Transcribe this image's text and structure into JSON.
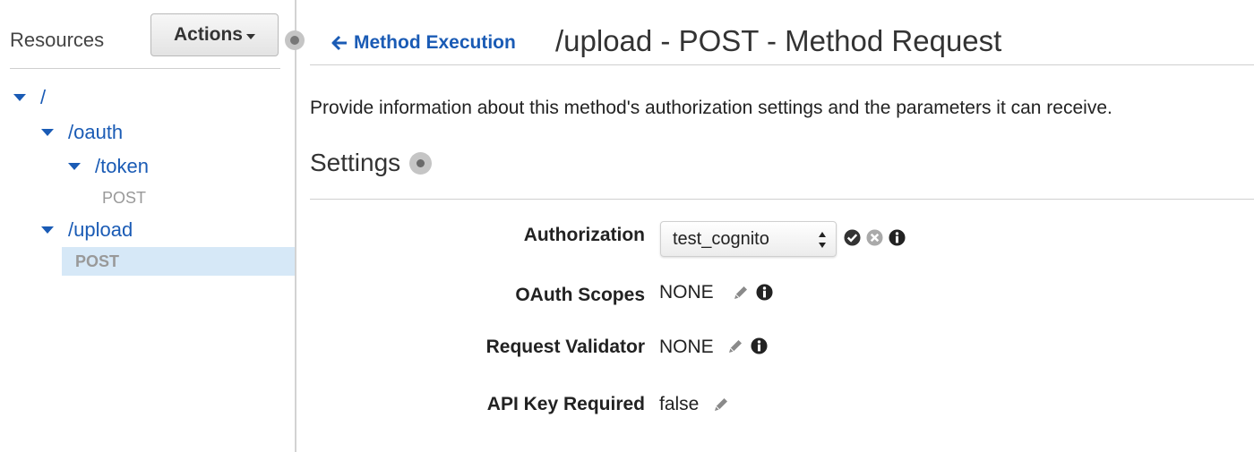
{
  "sidebar": {
    "title": "Resources",
    "actions_label": "Actions",
    "tree": {
      "root": "/",
      "oauth": "/oauth",
      "token": "/token",
      "token_method": "POST",
      "upload": "/upload",
      "upload_method": "POST"
    }
  },
  "header": {
    "back_label": "Method Execution",
    "title": "/upload - POST - Method Request"
  },
  "description": "Provide information about this method's authorization settings and the parameters it can receive.",
  "settings": {
    "heading": "Settings",
    "fields": {
      "authorization": {
        "label": "Authorization",
        "value": "test_cognito"
      },
      "oauth_scopes": {
        "label": "OAuth Scopes",
        "value": "NONE"
      },
      "request_validator": {
        "label": "Request Validator",
        "value": "NONE"
      },
      "api_key_required": {
        "label": "API Key Required",
        "value": "false"
      }
    }
  },
  "colors": {
    "link": "#1a5bb5",
    "selected_row": "#d6e8f7",
    "muted_method": "#999999"
  },
  "icons": [
    "chevron-down-icon",
    "arrow-left-icon",
    "collapse-knob-icon",
    "info-dot-icon",
    "check-circle-icon",
    "cancel-circle-icon",
    "info-icon",
    "pencil-icon",
    "select-arrows-icon"
  ]
}
